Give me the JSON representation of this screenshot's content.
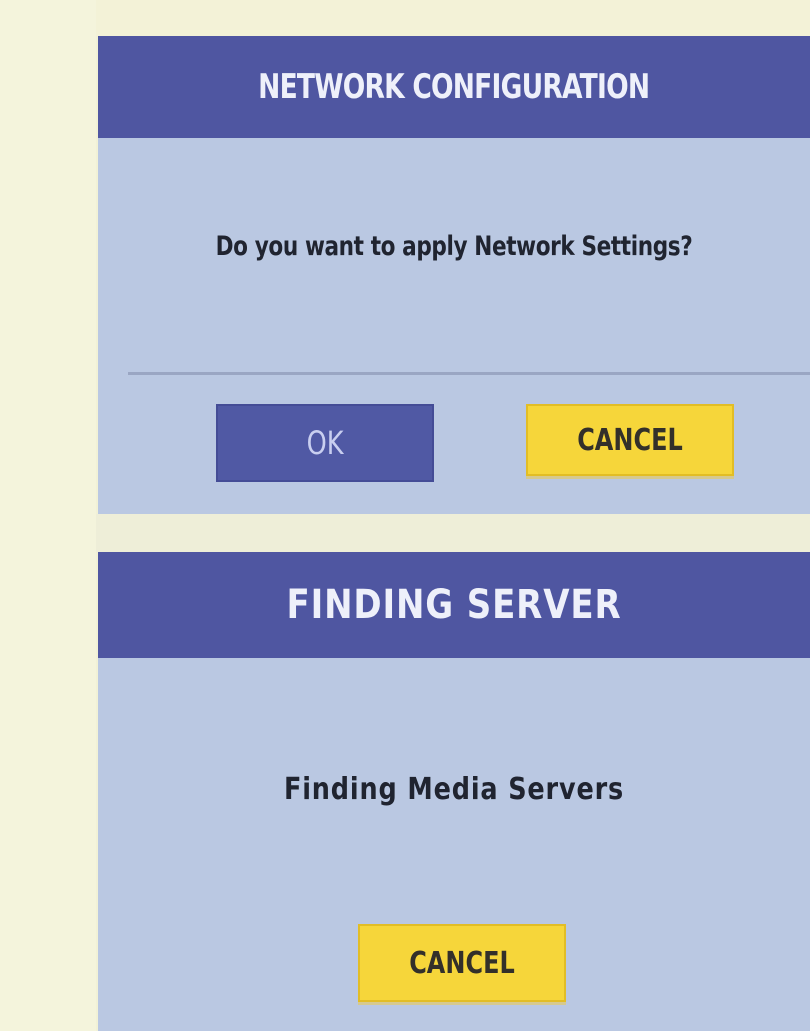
{
  "network_dialog": {
    "title": "NETWORK CONFIGURATION",
    "message": "Do you want to apply Network Settings?",
    "ok_label": "OK",
    "cancel_label": "CANCEL"
  },
  "finding_dialog": {
    "title": "FINDING SERVER",
    "message": "Finding Media Servers",
    "cancel_label": "CANCEL"
  },
  "colors": {
    "title_bar": "#4f56a1",
    "panel": "#bac8e2",
    "cancel_button": "#f6d63a",
    "ok_button": "#5059a4",
    "background": "#f1f1d6"
  }
}
